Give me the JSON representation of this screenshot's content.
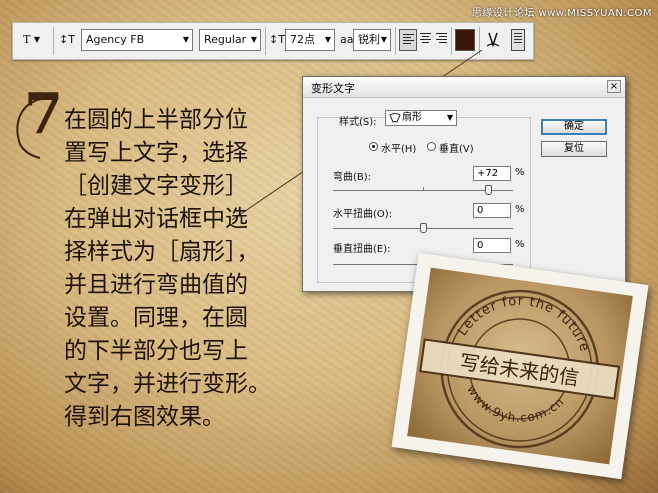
{
  "watermark": "思缘设计论坛 www.MISSYUAN.COM",
  "options_bar": {
    "tool_icon": "T",
    "font_family": "Agency FB",
    "font_style": "Regular",
    "font_size": "72点",
    "aa_icon": "aa",
    "anti_alias": "锐利",
    "text_color": "#3a1608"
  },
  "step": {
    "number": "7",
    "lines": [
      "在圆的上半部分位",
      "置写上文字，选择",
      "［创建文字变形］",
      "在弹出对话框中选",
      "择样式为［扇形］，",
      "并且进行弯曲值的",
      "设置。同理，在圆",
      "的下半部分也写上",
      "文字，并进行变形。",
      "得到右图效果。"
    ]
  },
  "dialog": {
    "title": "变形文字",
    "close": "×",
    "style_label": "样式(S):",
    "style_value": "扇形",
    "horizontal": "水平(H)",
    "vertical": "垂直(V)",
    "bend_label": "弯曲(B):",
    "bend_value": "+72",
    "bend": 72,
    "hdist_label": "水平扭曲(O):",
    "hdist_value": "0",
    "hdist": 0,
    "vdist_label": "垂直扭曲(E):",
    "vdist_value": "0",
    "vdist": 0,
    "percent": "%",
    "ok": "确定",
    "reset": "复位"
  },
  "stamp": {
    "top_arc": "Letter for the future",
    "banner": "写给未来的信",
    "bottom_arc": "www.9yh.com.cn"
  }
}
